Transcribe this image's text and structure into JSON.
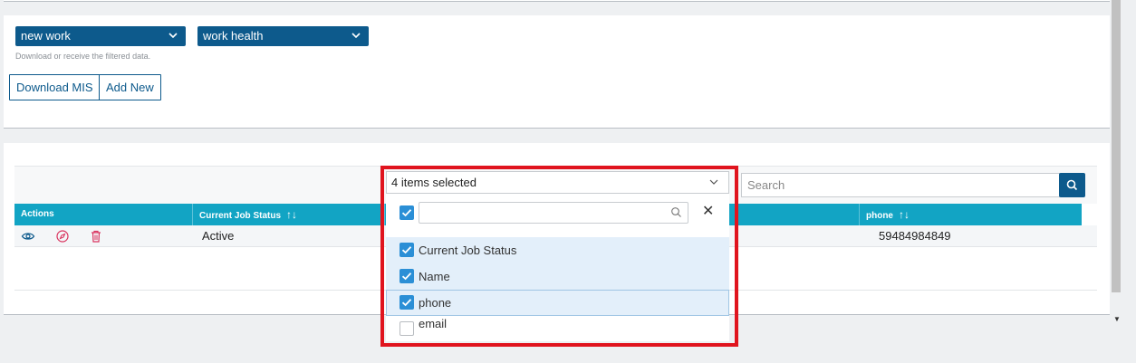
{
  "filters": {
    "select1_value": "new work",
    "select2_value": "work health",
    "hint": "Download or receive the filtered data.",
    "download_label": "Download MIS",
    "add_new_label": "Add New"
  },
  "search": {
    "placeholder": "Search"
  },
  "table": {
    "columns": [
      {
        "label": "Actions"
      },
      {
        "label": "Current Job Status"
      },
      {
        "label": "phone"
      }
    ],
    "rows": [
      {
        "current_job_status": "Active",
        "phone": "59484984849"
      }
    ],
    "action_icons": [
      "eye-icon",
      "compass-icon",
      "trash-icon"
    ]
  },
  "multiselect": {
    "header": "4 items selected",
    "items": [
      {
        "label": "Current Job Status",
        "checked": true
      },
      {
        "label": "Name",
        "checked": true
      },
      {
        "label": "phone",
        "checked": true
      },
      {
        "label": "email",
        "checked": false
      }
    ]
  },
  "colors": {
    "primary": "#0d5a8c",
    "table_header": "#12a4c4",
    "highlight": "#e0141e",
    "checkbox": "#2b8fd6",
    "icon_pink": "#d9345f"
  }
}
